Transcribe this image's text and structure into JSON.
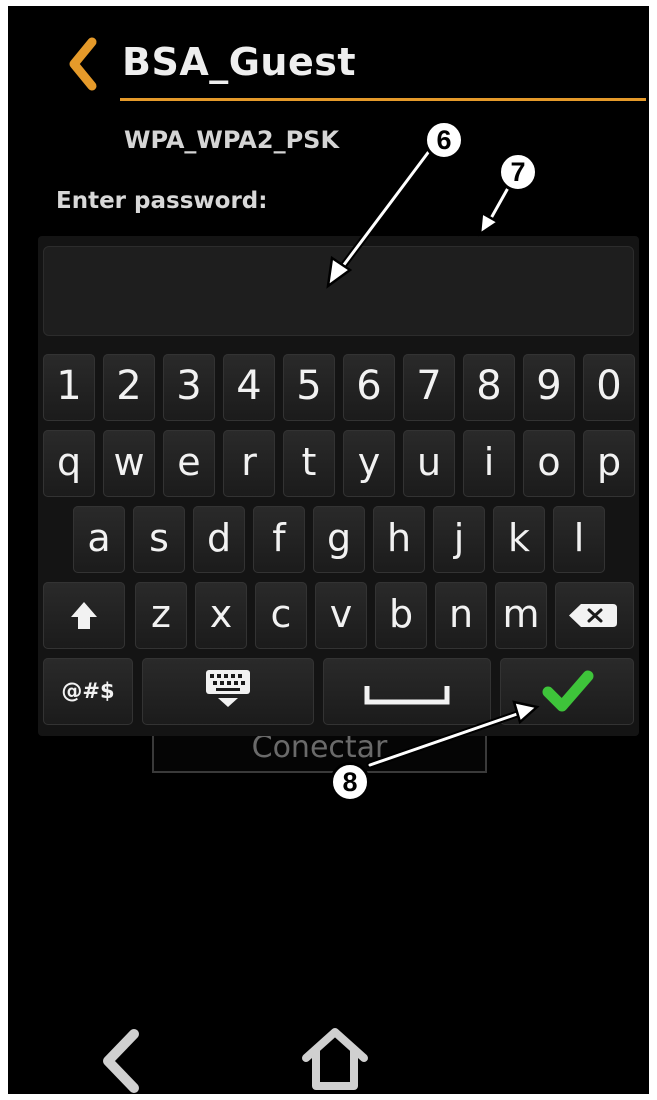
{
  "header": {
    "title": "BSA_Guest",
    "security_type": "WPA_WPA2_PSK"
  },
  "password": {
    "label": "Enter password:",
    "value": ""
  },
  "connect_button": {
    "label": "Conectar"
  },
  "keyboard": {
    "row_numbers": [
      "1",
      "2",
      "3",
      "4",
      "5",
      "6",
      "7",
      "8",
      "9",
      "0"
    ],
    "row_qwerty": [
      "q",
      "w",
      "e",
      "r",
      "t",
      "y",
      "u",
      "i",
      "o",
      "p"
    ],
    "row_home": [
      "a",
      "s",
      "d",
      "f",
      "g",
      "h",
      "j",
      "k",
      "l"
    ],
    "row_bottom": [
      "z",
      "x",
      "c",
      "v",
      "b",
      "n",
      "m"
    ],
    "symbols_label": "@#$"
  },
  "callouts": {
    "c6": "6",
    "c7": "7",
    "c8": "8"
  },
  "colors": {
    "accent": "#e59a2a",
    "confirm": "#3ec43a",
    "background": "#000000"
  },
  "icons": [
    "back-chevron-icon",
    "shift-icon",
    "backspace-icon",
    "keyboard-hide-icon",
    "space-bar-icon",
    "checkmark-icon",
    "nav-back-icon",
    "home-icon"
  ]
}
